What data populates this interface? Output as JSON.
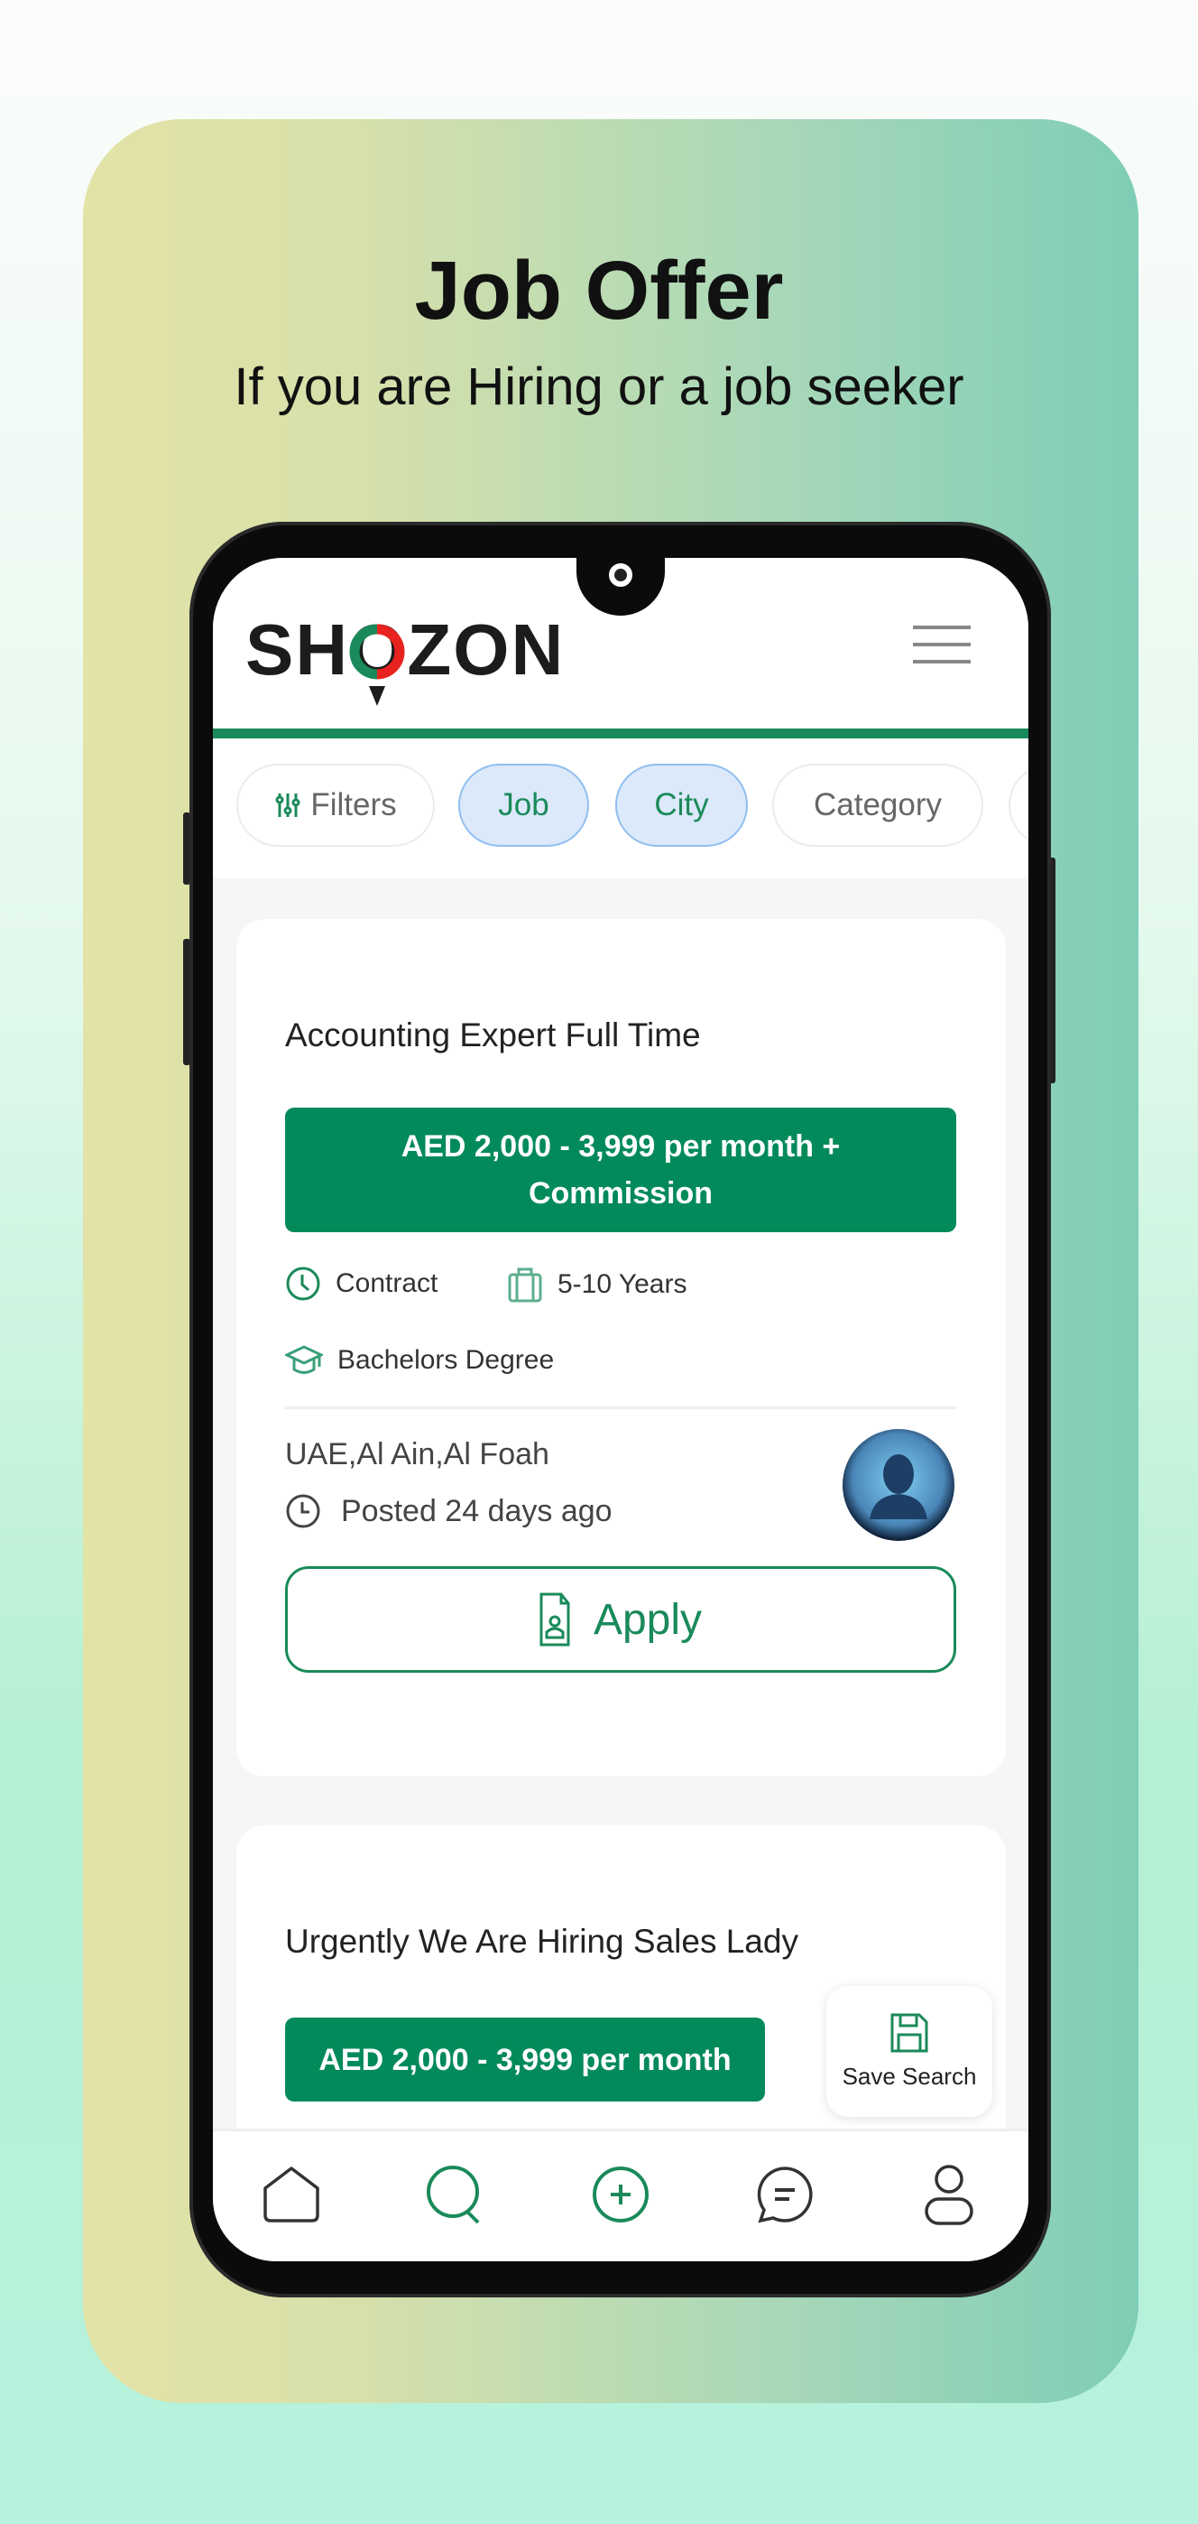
{
  "promo": {
    "title": "Job Offer",
    "subtitle": "If you are Hiring or a job seeker"
  },
  "app": {
    "logo": "SHOZON",
    "menu_icon": "hamburger-icon",
    "chips": [
      {
        "label": "Filters",
        "icon": "sliders-icon"
      },
      {
        "label": "Job",
        "selected": true
      },
      {
        "label": "City",
        "selected": true
      },
      {
        "label": "Category"
      }
    ],
    "jobs": [
      {
        "title": "Accounting Expert Full Time",
        "salary_line1": "AED 2,000 - 3,999 per month +",
        "salary_line2": "Commission",
        "type": "Contract",
        "experience": "5-10 Years",
        "education": "Bachelors Degree",
        "location": "UAE,Al Ain,Al Foah",
        "posted": "Posted 24 days ago",
        "apply_label": "Apply"
      },
      {
        "title": "Urgently We Are Hiring Sales Lady",
        "salary_line1": "AED 2,000 - 3,999 per month"
      }
    ],
    "save_search_label": "Save Search",
    "bottom_nav": [
      {
        "icon": "home-icon"
      },
      {
        "icon": "search-icon",
        "active": true
      },
      {
        "icon": "add-icon"
      },
      {
        "icon": "chat-icon"
      },
      {
        "icon": "profile-icon"
      }
    ]
  },
  "colors": {
    "brand_green": "#038a5a",
    "chip_selected_bg": "#dbe9fb",
    "logo_red": "#e8231f"
  }
}
